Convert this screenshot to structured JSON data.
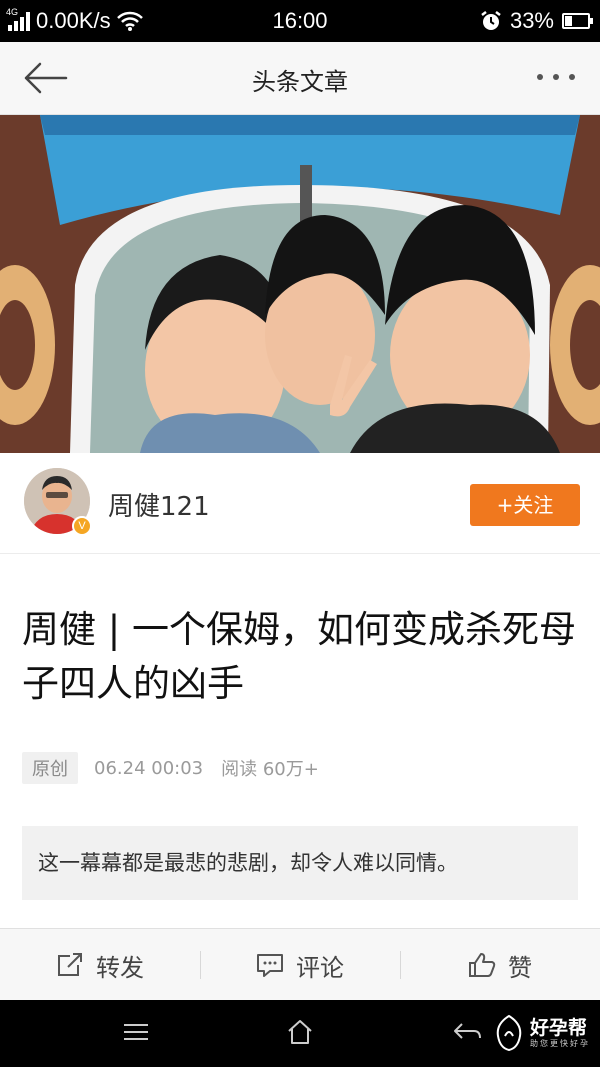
{
  "status_bar": {
    "network_type": "4G",
    "speed": "0.00K/s",
    "time": "16:00",
    "battery_percent": "33%",
    "battery_level": 0.33,
    "icons": [
      "signal-icon",
      "wifi-icon",
      "alarm-icon",
      "battery-icon"
    ]
  },
  "header": {
    "title": "头条文章",
    "back_icon": "back-arrow-icon",
    "more_icon": "more-dots-icon"
  },
  "hero": {
    "image": "photo-three-children"
  },
  "author": {
    "name": "周健121",
    "follow_label": "+关注",
    "verified_badge": "V"
  },
  "article": {
    "title": "周健 | 一个保姆，如何变成杀死母子四人的凶手",
    "tag": "原创",
    "date": "06.24 00:03",
    "reads": "阅读 60万+",
    "summary": "这一幕幕都是最悲的悲剧，却令人难以同情。"
  },
  "actions": {
    "share": "转发",
    "comment": "评论",
    "like": "赞"
  },
  "watermark": {
    "name": "好孕帮",
    "slogan": "助您更快好孕"
  },
  "colors": {
    "accent": "#f0781e",
    "badge": "#f5a623"
  }
}
